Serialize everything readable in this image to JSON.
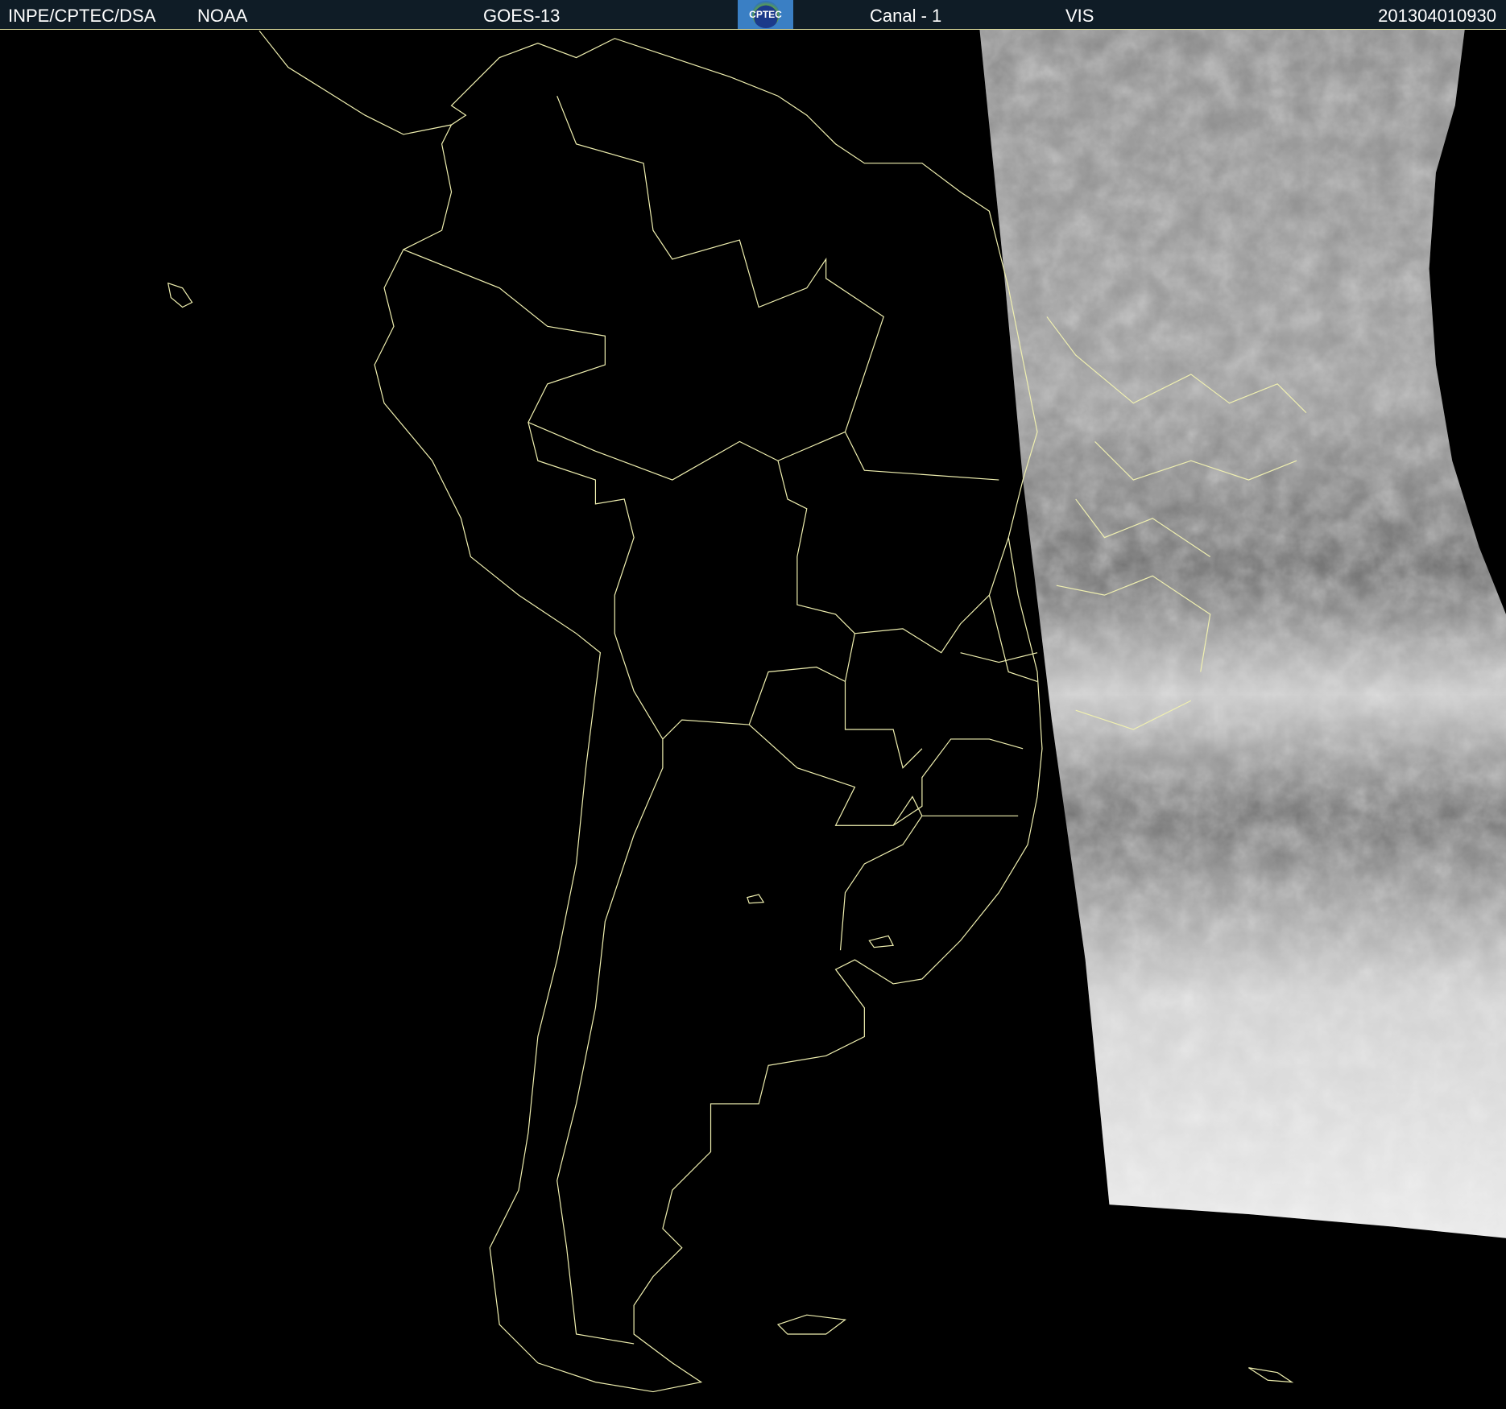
{
  "header": {
    "source": "INPE/CPTEC/DSA",
    "agency": "NOAA",
    "satellite": "GOES-13",
    "logo_text": "CPTEC",
    "channel": "Canal - 1",
    "band": "VIS",
    "timestamp": "201304010930"
  },
  "colors": {
    "header_bg": "#0f1c26",
    "coastline": "#f0f0b0",
    "background": "#000000"
  }
}
